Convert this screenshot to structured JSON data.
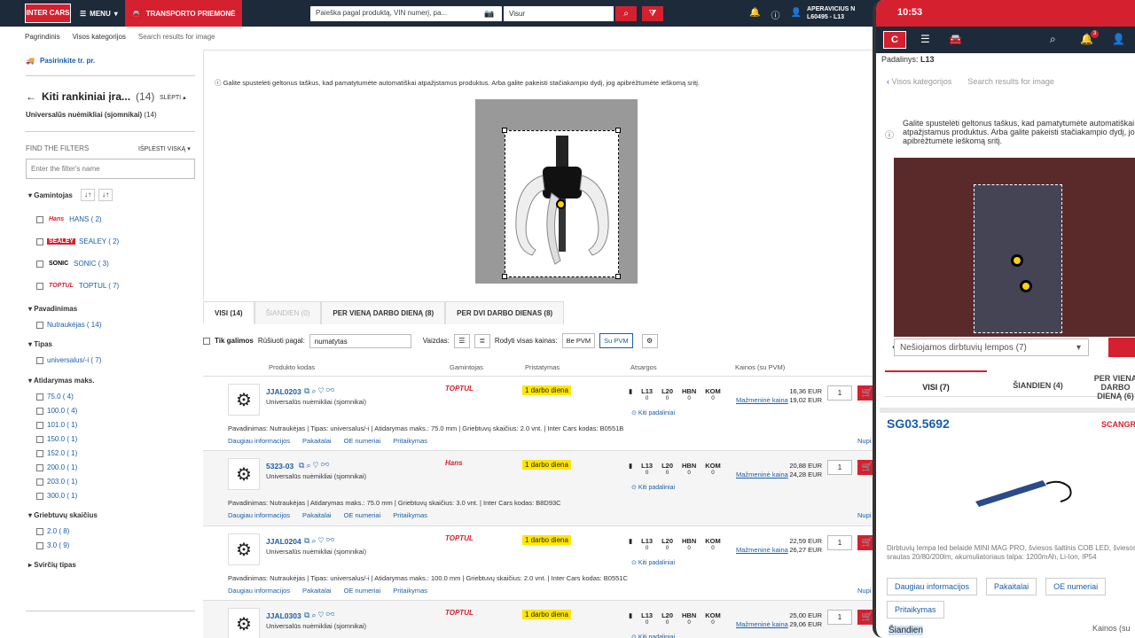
{
  "topbar": {
    "logo": "INTER CARS",
    "menu": "MENU",
    "transport": "TRANSPORTO PRIEMONĖ",
    "search_placeholder": "Paieška pagal produktą, VIN numerį, pa...",
    "scope": "Visur",
    "user_name": "APERAVICIUS N",
    "user_branch": "L60495 - L13"
  },
  "breadcrumb": [
    "Pagrindinis",
    "Visos kategorijos",
    "Search results for image"
  ],
  "vehicle_link": "Pasirinkite tr. pr.",
  "category": {
    "title": "Kiti rankiniai įra...",
    "count": "(14)",
    "hide": "SLĖPTI",
    "sub": "Universalūs nuėmikliai (sjomnikai)",
    "sub_count": "(14)"
  },
  "filters": {
    "find_label": "FIND THE FILTERS",
    "expand_all": "IŠPLĖSTI VISKĄ",
    "input_placeholder": "Enter the filter's name",
    "manufacturer": {
      "title": "Gamintojas",
      "items": [
        {
          "logo": "Hans",
          "label": "HANS ( 2)"
        },
        {
          "logo": "SEALEY",
          "label": "SEALEY ( 2)"
        },
        {
          "logo": "SONIC",
          "label": "SONIC ( 3)"
        },
        {
          "logo": "TOPTUL",
          "label": "TOPTUL ( 7)"
        }
      ]
    },
    "name": {
      "title": "Pavadinimas",
      "items": [
        "Nutraukėjas ( 14)"
      ]
    },
    "type": {
      "title": "Tipas",
      "items": [
        "universalus/-i ( 7)"
      ]
    },
    "opening": {
      "title": "Atidarymas maks.",
      "items": [
        "75.0 ( 4)",
        "100.0 ( 4)",
        "101.0 ( 1)",
        "150.0 ( 1)",
        "152.0 ( 1)",
        "200.0 ( 1)",
        "203.0 ( 1)",
        "300.0 ( 1)"
      ]
    },
    "grips": {
      "title": "Griebtuvų skaičius",
      "items": [
        "2.0 ( 8)",
        "3.0 ( 9)"
      ]
    },
    "lever": {
      "title": "Svirčių tipas"
    }
  },
  "image_search": {
    "info": "Galite spustelėti geltonus taškus, kad pamatytumėte automatiškai atpažįstamus produktus. Arba galite pakeisti stačiakampio dydį, jog apibrėžtumėte ieškomą sritį."
  },
  "tabs": [
    "VISI (14)",
    "ŠIANDIEN (0)",
    "PER VIENĄ DARBO DIENĄ (8)",
    "PER DVI DARBO DIENAS (8)"
  ],
  "controls": {
    "only_available": "Tik galimos",
    "sort_label": "Rūšiuoti pagal:",
    "sort_value": "numatytas",
    "view_label": "Vaizdas:",
    "prices_label": "Rodyti visas kainas:",
    "without_vat": "Be PVM",
    "with_vat": "Su PVM"
  },
  "columns": {
    "code": "Produkto kodas",
    "maker": "Gamintojas",
    "delivery": "Pristatymas",
    "stock": "Atsargos",
    "prices": "Kainos (su PVM)"
  },
  "products": [
    {
      "code": "JJAL0203",
      "name": "Universalūs nuėmikliai (sjomnikai)",
      "brand": "TOPTUL",
      "delivery": "1 darbo diena",
      "price1": "16,36 EUR",
      "price2": "19,02 EUR",
      "qty": "1",
      "desc": "Pavadinimas: Nutraukėjas | Tipas: universalus/-i | Atidarymas maks.: 75.0 mm | Griebtuvų skaičius: 2.0 vnt. | Inter Cars kodas: B0551B"
    },
    {
      "code": "5323-03",
      "name": "Universalūs nuėmikliai (sjomnikai)",
      "brand": "Hans",
      "delivery": "1 darbo diena",
      "price1": "20,88 EUR",
      "price2": "24,28 EUR",
      "qty": "1",
      "desc": "Pavadinimas: Nutraukėjas | Atidarymas maks.: 75.0 mm | Griebtuvų skaičius: 3.0 vnt. | Inter Cars kodas: B8D93C"
    },
    {
      "code": "JJAL0204",
      "name": "Universalūs nuėmikliai (sjomnikai)",
      "brand": "TOPTUL",
      "delivery": "1 darbo diena",
      "price1": "22,59 EUR",
      "price2": "26,27 EUR",
      "qty": "1",
      "desc": "Pavadinimas: Nutraukėjas | Tipas: universalus/-i | Atidarymas maks.: 100.0 mm | Griebtuvų skaičius: 2.0 vnt. | Inter Cars kodas: B0551C"
    },
    {
      "code": "JJAL0303",
      "name": "Universalūs nuėmikliai (sjomnikai)",
      "brand": "TOPTUL",
      "delivery": "1 darbo diena",
      "price1": "25,00 EUR",
      "price2": "29,06 EUR",
      "qty": "1",
      "desc": ""
    }
  ],
  "stock_cols": [
    "L13",
    "L20",
    "HBN",
    "KOM"
  ],
  "stock_vals": "0",
  "other_branches": "Kiti padaliniai",
  "retail_price": "Mažmeninė kaina",
  "row_links": [
    "Daugiau informacijos",
    "Pakaitalai",
    "OE numeriai",
    "Pritaikymas"
  ],
  "nupi": "Nupi",
  "phone": {
    "time": "10:53",
    "branch_label": "Padalinys:",
    "branch": "L13",
    "crumbs": [
      "Visos kategorijos",
      "Search results for image"
    ],
    "info": "Galite spustelėti geltonus taškus, kad pamatytumėte automatiškai atpažįstamus produktus. Arba galite pakeisti stačiakampio dydį, jog apibrėžtumėte ieškomą sritį.",
    "select": "Nešiojamos dirbtuvių lempos (7)",
    "tabs": [
      "VISI (7)",
      "ŠIANDIEN (4)",
      "PER VIENĄ DARBO DIENĄ (6)"
    ],
    "product_code": "SG03.5692",
    "product_brand": "SCANGRIP",
    "product_desc": "Dirbtuvių lempa led belaidė MINI MAG PRO, šviesos šaltinis COB LED, šviesos srautas 20/80/200lm, akumuliatoriaus talpa: 1200mAh, Li-Ion, IP54",
    "buttons": [
      "Daugiau informacijos",
      "Pakaitalai",
      "OE numeriai"
    ],
    "button_fit": "Pritaikymas",
    "today": "Šiandien",
    "prices": "Kainos (su"
  }
}
